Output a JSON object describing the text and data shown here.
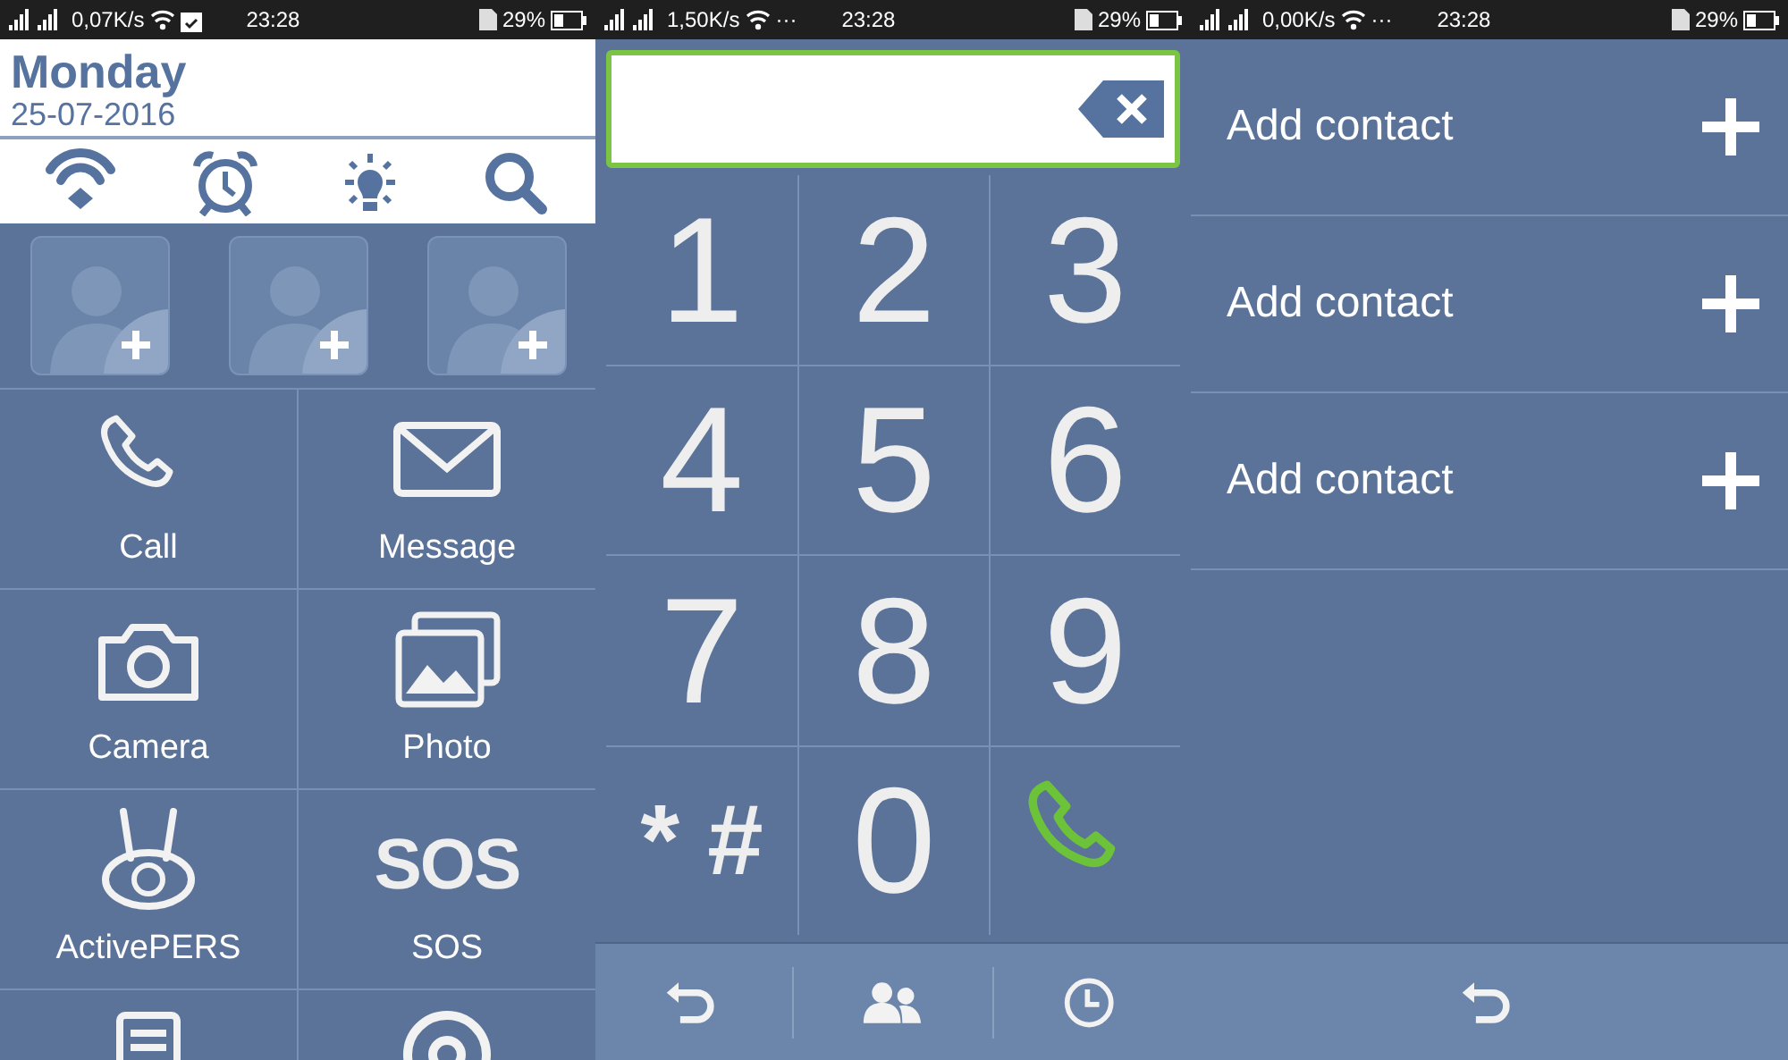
{
  "screens": [
    {
      "status_bar": {
        "speed": "0,07K/s",
        "extra": {
          "kind": "clipboard"
        },
        "time": "23:28",
        "battery": "29%"
      },
      "header": {
        "day": "Monday",
        "date": "25-07-2016"
      },
      "quick_icons": [
        {
          "kind": "wifi"
        },
        {
          "kind": "alarm"
        },
        {
          "kind": "bulb"
        },
        {
          "kind": "search"
        }
      ],
      "contact_slots": [
        {
          "kind": "empty"
        },
        {
          "kind": "empty"
        },
        {
          "kind": "empty"
        }
      ],
      "app_rows": [
        [
          {
            "kind": "phone",
            "label": "Call"
          },
          {
            "kind": "mail",
            "label": "Message"
          }
        ],
        [
          {
            "kind": "camera",
            "label": "Camera"
          },
          {
            "kind": "photo",
            "label": "Photo"
          }
        ],
        [
          {
            "kind": "pers",
            "label": "ActivePERS"
          },
          {
            "kind": "sos",
            "glyph": "SOS",
            "label": "SOS"
          }
        ],
        [
          {
            "kind": "book"
          },
          {
            "kind": "pin"
          }
        ]
      ]
    },
    {
      "status_bar": {
        "speed": "1,50K/s",
        "extra": {
          "kind": "text",
          "text": "···"
        },
        "time": "23:28",
        "battery": "29%"
      },
      "keys": [
        {
          "kind": "digit",
          "label": "1"
        },
        {
          "kind": "digit",
          "label": "2"
        },
        {
          "kind": "digit",
          "label": "3"
        },
        {
          "kind": "digit",
          "label": "4"
        },
        {
          "kind": "digit",
          "label": "5"
        },
        {
          "kind": "digit",
          "label": "6"
        },
        {
          "kind": "digit",
          "label": "7"
        },
        {
          "kind": "digit",
          "label": "8"
        },
        {
          "kind": "digit",
          "label": "9"
        },
        {
          "kind": "symbols",
          "label": "* #"
        },
        {
          "kind": "digit",
          "label": "0"
        },
        {
          "kind": "call"
        }
      ],
      "bottom_bar": [
        {
          "kind": "back"
        },
        {
          "kind": "contacts"
        },
        {
          "kind": "history"
        }
      ]
    },
    {
      "status_bar": {
        "speed": "0,00K/s",
        "extra": {
          "kind": "text",
          "text": "···"
        },
        "time": "23:28",
        "battery": "29%"
      },
      "contact_rows": [
        {
          "label": "Add contact"
        },
        {
          "label": "Add contact"
        },
        {
          "label": "Add contact"
        }
      ],
      "bottom_bar": [
        {
          "kind": "back"
        }
      ]
    }
  ]
}
